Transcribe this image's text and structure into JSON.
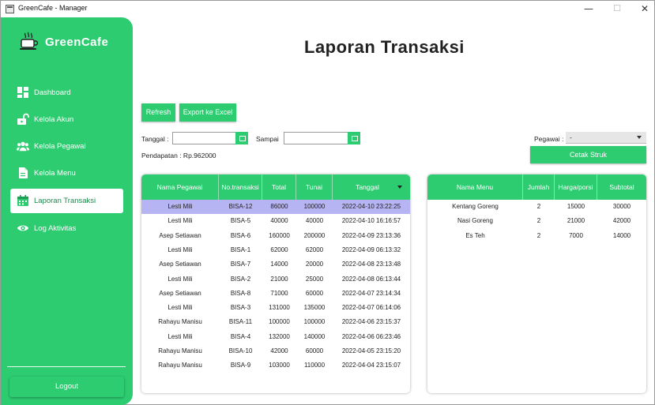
{
  "window": {
    "title": "GreenCafe - Manager",
    "min": "—",
    "max": "☐",
    "close": "✕"
  },
  "brand": {
    "name": "GreenCafe",
    "icon": "coffee-cup-icon"
  },
  "colors": {
    "accent": "#2ecc71",
    "selected_row": "#b7b4f4",
    "text": "#222222"
  },
  "nav": [
    {
      "label": "Dashboard",
      "icon": "dashboard-icon"
    },
    {
      "label": "Kelola Akun",
      "icon": "unlock-icon"
    },
    {
      "label": "Kelola Pegawai",
      "icon": "users-icon"
    },
    {
      "label": "Kelola Menu",
      "icon": "document-icon"
    },
    {
      "label": "Laporan Transaksi",
      "icon": "calendar-icon",
      "active": true
    },
    {
      "label": "Log Aktivitas",
      "icon": "eye-icon"
    }
  ],
  "logout_label": "Logout",
  "page_title": "Laporan Transaksi",
  "toolbar": {
    "refresh_label": "Refresh",
    "export_label": "Export ke Excel"
  },
  "filters": {
    "tanggal_label": "Tanggal :",
    "tanggal_value": "",
    "sampai_label": "Sampai",
    "sampai_value": "",
    "pegawai_label": "Pegawai :",
    "pegawai_value": "-"
  },
  "pendapatan": "Pendapatan : Rp.962000",
  "cetak_label": "Cetak Struk",
  "transactions": {
    "columns": [
      "Nama Pegawai",
      "No.transaksi",
      "Total",
      "Tunai",
      "Tanggal"
    ],
    "rows": [
      [
        "Lesti Mili",
        "BISA-12",
        "86000",
        "100000",
        "2022-04-10 23:22:25"
      ],
      [
        "Lesti Mili",
        "BISA-5",
        "40000",
        "40000",
        "2022-04-10 16:16:57"
      ],
      [
        "Asep Setiawan",
        "BISA-6",
        "160000",
        "200000",
        "2022-04-09 23:13:36"
      ],
      [
        "Lesti Mili",
        "BISA-1",
        "62000",
        "62000",
        "2022-04-09 06:13:32"
      ],
      [
        "Asep Setiawan",
        "BISA-7",
        "14000",
        "20000",
        "2022-04-08 23:13:48"
      ],
      [
        "Lesti Mili",
        "BISA-2",
        "21000",
        "25000",
        "2022-04-08 06:13:44"
      ],
      [
        "Asep Setiawan",
        "BISA-8",
        "71000",
        "60000",
        "2022-04-07 23:14:34"
      ],
      [
        "Lesti Mili",
        "BISA-3",
        "131000",
        "135000",
        "2022-04-07 06:14:06"
      ],
      [
        "Rahayu Manisu",
        "BISA-11",
        "100000",
        "100000",
        "2022-04-06 23:15:37"
      ],
      [
        "Lesti Mili",
        "BISA-4",
        "132000",
        "140000",
        "2022-04-06 06:23:46"
      ],
      [
        "Rahayu Manisu",
        "BISA-10",
        "42000",
        "60000",
        "2022-04-05 23:15:20"
      ],
      [
        "Rahayu Manisu",
        "BISA-9",
        "103000",
        "110000",
        "2022-04-04 23:15:07"
      ]
    ],
    "selected_index": 0
  },
  "details": {
    "columns": [
      "Nama Menu",
      "Jumlah",
      "Harga/porsi",
      "Subtotal"
    ],
    "rows": [
      [
        "Kentang Goreng",
        "2",
        "15000",
        "30000"
      ],
      [
        "Nasi Goreng",
        "2",
        "21000",
        "42000"
      ],
      [
        "Es Teh",
        "2",
        "7000",
        "14000"
      ]
    ]
  }
}
